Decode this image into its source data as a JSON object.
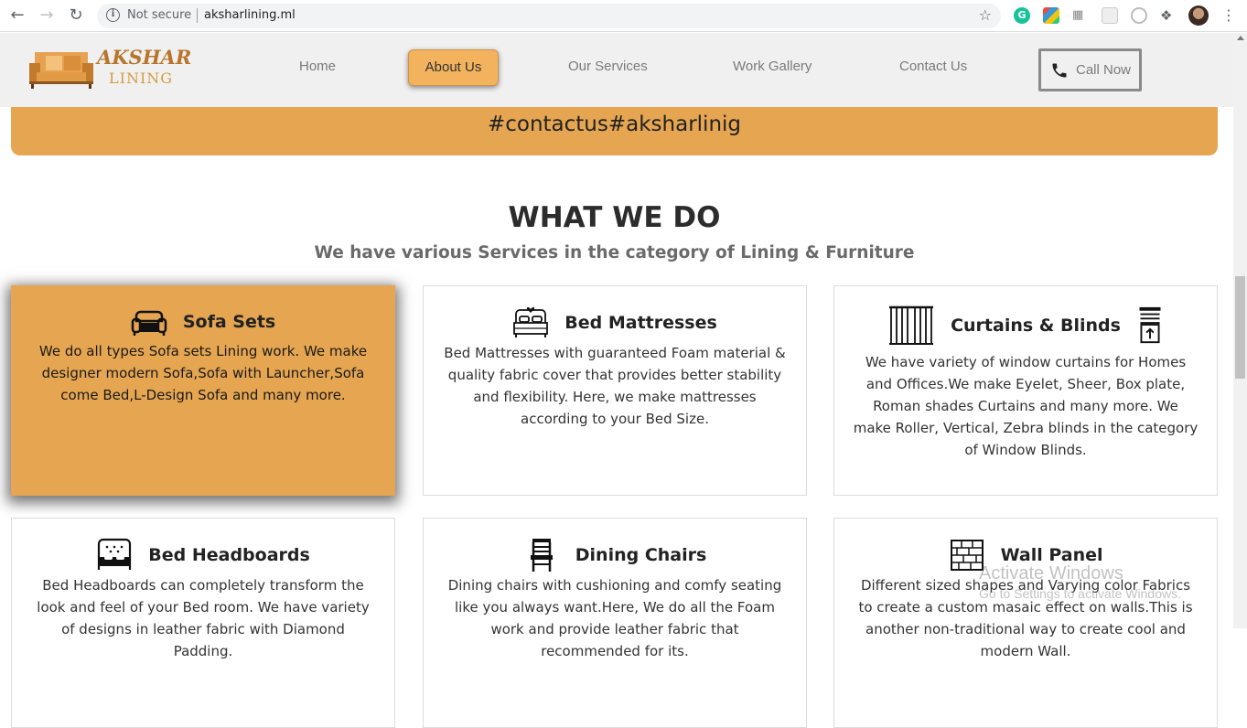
{
  "browser": {
    "security_label": "Not secure",
    "url": "aksharlining.ml",
    "extension_g_letter": "G"
  },
  "logo": {
    "line1": "AKSHAR",
    "line2": "LINING"
  },
  "nav": {
    "items": [
      {
        "label": "Home"
      },
      {
        "label": "About Us",
        "active": true
      },
      {
        "label": "Our Services"
      },
      {
        "label": "Work Gallery"
      },
      {
        "label": "Contact Us"
      }
    ],
    "call_label": "Call Now"
  },
  "banner": {
    "text": "#contactus#aksharlinig"
  },
  "services": {
    "title": "WHAT WE DO",
    "subtitle": "We have various Services in the category of Lining & Furniture",
    "cards": [
      {
        "title": "Sofa Sets",
        "icon": "sofa-icon",
        "text": "We do all types Sofa sets Lining work. We make designer modern Sofa,Sofa with Launcher,Sofa come Bed,L-Design Sofa and many more."
      },
      {
        "title": "Bed Mattresses",
        "icon": "bed-icon",
        "text": "Bed Mattresses with guaranteed Foam material & quality fabric cover that provides better stability and flexibility. Here, we make mattresses according to your Bed Size."
      },
      {
        "title": "Curtains & Blinds",
        "icon": "curtain-icon",
        "text": "We have variety of window curtains for Homes and Offices.We make Eyelet, Sheer, Box plate, Roman shades Curtains and many more. We make Roller, Vertical, Zebra blinds in the category of Window Blinds."
      },
      {
        "title": "Bed Headboards",
        "icon": "headboard-icon",
        "text": "Bed Headboards can completely transform the look and feel of your Bed room. We have variety of designs in leather fabric with Diamond Padding."
      },
      {
        "title": "Dining Chairs",
        "icon": "chair-icon",
        "text": "Dining chairs with cushioning and comfy seating like you always want.Here, We do all the Foam work and provide leather fabric that recommended for its."
      },
      {
        "title": "Wall Panel",
        "icon": "wall-panel-icon",
        "text": "Different sized shapes and Varying color Fabrics to create a custom masaic effect on walls.This is another non-traditional way to create cool and modern Wall."
      }
    ]
  },
  "watermark": {
    "line1": "Activate Windows",
    "line2": "Go to Settings to activate Windows."
  },
  "colors": {
    "accent": "#e5a551",
    "nav_active": "#f2b25e"
  }
}
